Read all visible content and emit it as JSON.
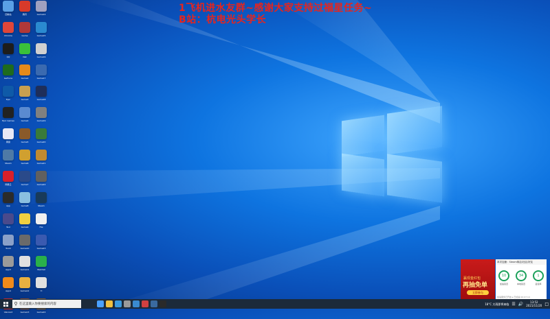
{
  "overlay": {
    "line1": "1飞机进水友群~感谢大家支持过福星任务~",
    "line2": "B站：杭电光头学长"
  },
  "desktop_icons": [
    {
      "label": "回收站",
      "color": "#5aa0e6"
    },
    {
      "label": "Chrome",
      "color": "#e0463a"
    },
    {
      "label": "QQ",
      "color": "#1d1d1d"
    },
    {
      "label": "GeForce",
      "color": "#1e6b1e"
    },
    {
      "label": "Epic",
      "color": "#0f5aa8"
    },
    {
      "label": "Epic Games",
      "color": "#222222"
    },
    {
      "label": "网易",
      "color": "#e8e8f5"
    },
    {
      "label": "Steam",
      "color": "#4e7aa6"
    },
    {
      "label": "网易云",
      "color": "#d81f2a"
    },
    {
      "label": "App",
      "color": "#2b2b2b"
    },
    {
      "label": "Tool",
      "color": "#4a4a8c"
    },
    {
      "label": "Tool2",
      "color": "#8aa0c8"
    },
    {
      "label": "App3",
      "color": "#9a9a9a"
    },
    {
      "label": "App4",
      "color": "#f08a1a"
    },
    {
      "label": "Valorant",
      "color": "#c62a2a"
    },
    {
      "label": "腾讯",
      "color": "#d83a2a"
    },
    {
      "label": "Game",
      "color": "#b03838"
    },
    {
      "label": "Net",
      "color": "#3ac03a"
    },
    {
      "label": "Game2",
      "color": "#e68a1a"
    },
    {
      "label": "Game3",
      "color": "#c8a050"
    },
    {
      "label": "Game4",
      "color": "#5a8ad0"
    },
    {
      "label": "Game5",
      "color": "#8a5a2a"
    },
    {
      "label": "Game6",
      "color": "#d0a030"
    },
    {
      "label": "Game7",
      "color": "#2a4a8a"
    },
    {
      "label": "Game8",
      "color": "#8ac0e0"
    },
    {
      "label": "Game9",
      "color": "#f0d040"
    },
    {
      "label": "Game10",
      "color": "#6a6a6a"
    },
    {
      "label": "Game11",
      "color": "#e0e0e0"
    },
    {
      "label": "Game12",
      "color": "#e8b040"
    },
    {
      "label": "Game13",
      "color": "#8a5030"
    },
    {
      "label": "Game14",
      "color": "#a0a0c0"
    },
    {
      "label": "Game15",
      "color": "#2a8ad0"
    },
    {
      "label": "Game16",
      "color": "#d0d0d0"
    },
    {
      "label": "Game17",
      "color": "#3a6ab0"
    },
    {
      "label": "Game18",
      "color": "#1e2e5a"
    },
    {
      "label": "Game19",
      "color": "#808080"
    },
    {
      "label": "Game20",
      "color": "#3a7a3a"
    },
    {
      "label": "Game21",
      "color": "#c08a30"
    },
    {
      "label": "Game22",
      "color": "#606060"
    },
    {
      "label": "Steam",
      "color": "#183a5a"
    },
    {
      "label": "File",
      "color": "#f0f0f0"
    },
    {
      "label": "Game23",
      "color": "#3a5ab0"
    },
    {
      "label": "WeChat",
      "color": "#2ab04a"
    },
    {
      "label": "YI",
      "color": "#e0e0e0"
    },
    {
      "label": "Game24",
      "color": "#8a6030"
    }
  ],
  "taskbar": {
    "search_placeholder": "在这里输入你要搜索的内容",
    "apps": [
      "#4aa0ff",
      "#f0c040",
      "#3a9ae0",
      "#9a9a9a",
      "#3a8ad0",
      "#d04040",
      "#3a6aa0",
      "#2a2a2a"
    ],
    "weather": "18°C 大雨即将来临",
    "time": "13:52",
    "date": "2021/11/20"
  },
  "popup": {
    "left_small": "赢现金红包",
    "left_big": "再抽免单",
    "left_btn": "立即参与",
    "header": "本次加速：Steam商店/社区/好友",
    "stats": [
      {
        "value": "10",
        "caption": "加速延迟"
      },
      {
        "value": "34",
        "caption": "本地延迟"
      },
      {
        "value": "1",
        "caption": "丢包率"
      }
    ],
    "footer": "加速服务已开启 ▸ 已加速 00:07:14"
  }
}
